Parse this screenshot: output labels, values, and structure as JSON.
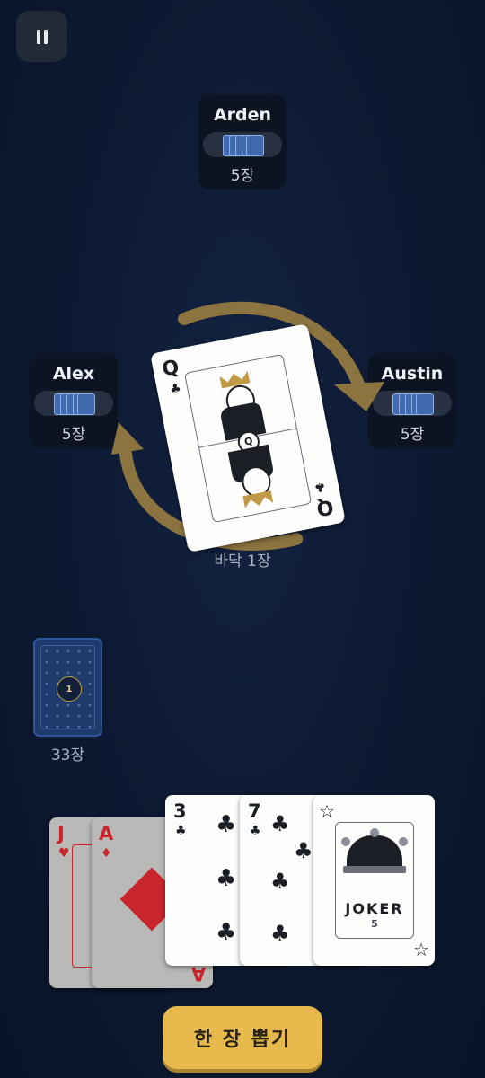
{
  "players": {
    "top": {
      "name": "Arden",
      "count": "5장"
    },
    "left": {
      "name": "Alex",
      "count": "5장"
    },
    "right": {
      "name": "Austin",
      "count": "5장"
    }
  },
  "table": {
    "center_card": {
      "rank": "Q",
      "suit": "clubs",
      "face_letter": "Q"
    },
    "pile_label": "바닥 1장",
    "direction": "clockwise"
  },
  "deck": {
    "badge": "1",
    "count_label": "33장"
  },
  "hand": [
    {
      "rank": "J",
      "suit": "hearts",
      "state": "disabled"
    },
    {
      "rank": "A",
      "suit": "diamonds",
      "state": "disabled"
    },
    {
      "rank": "3",
      "suit": "clubs",
      "state": "playable"
    },
    {
      "rank": "7",
      "suit": "clubs",
      "state": "playable"
    },
    {
      "rank": "JOKER",
      "value": "5",
      "state": "playable"
    }
  ],
  "draw_button": {
    "label": "한 장 뽑기"
  },
  "colors": {
    "accent": "#e7b84c",
    "arrow": "#8c7440",
    "card_back": "#1f3a6c",
    "background": "#0d1a33",
    "red_suit": "#c8262c",
    "black_suit": "#1b1e24"
  },
  "icons": {
    "pause": "pause-icon",
    "direction": "direction-arrows"
  }
}
